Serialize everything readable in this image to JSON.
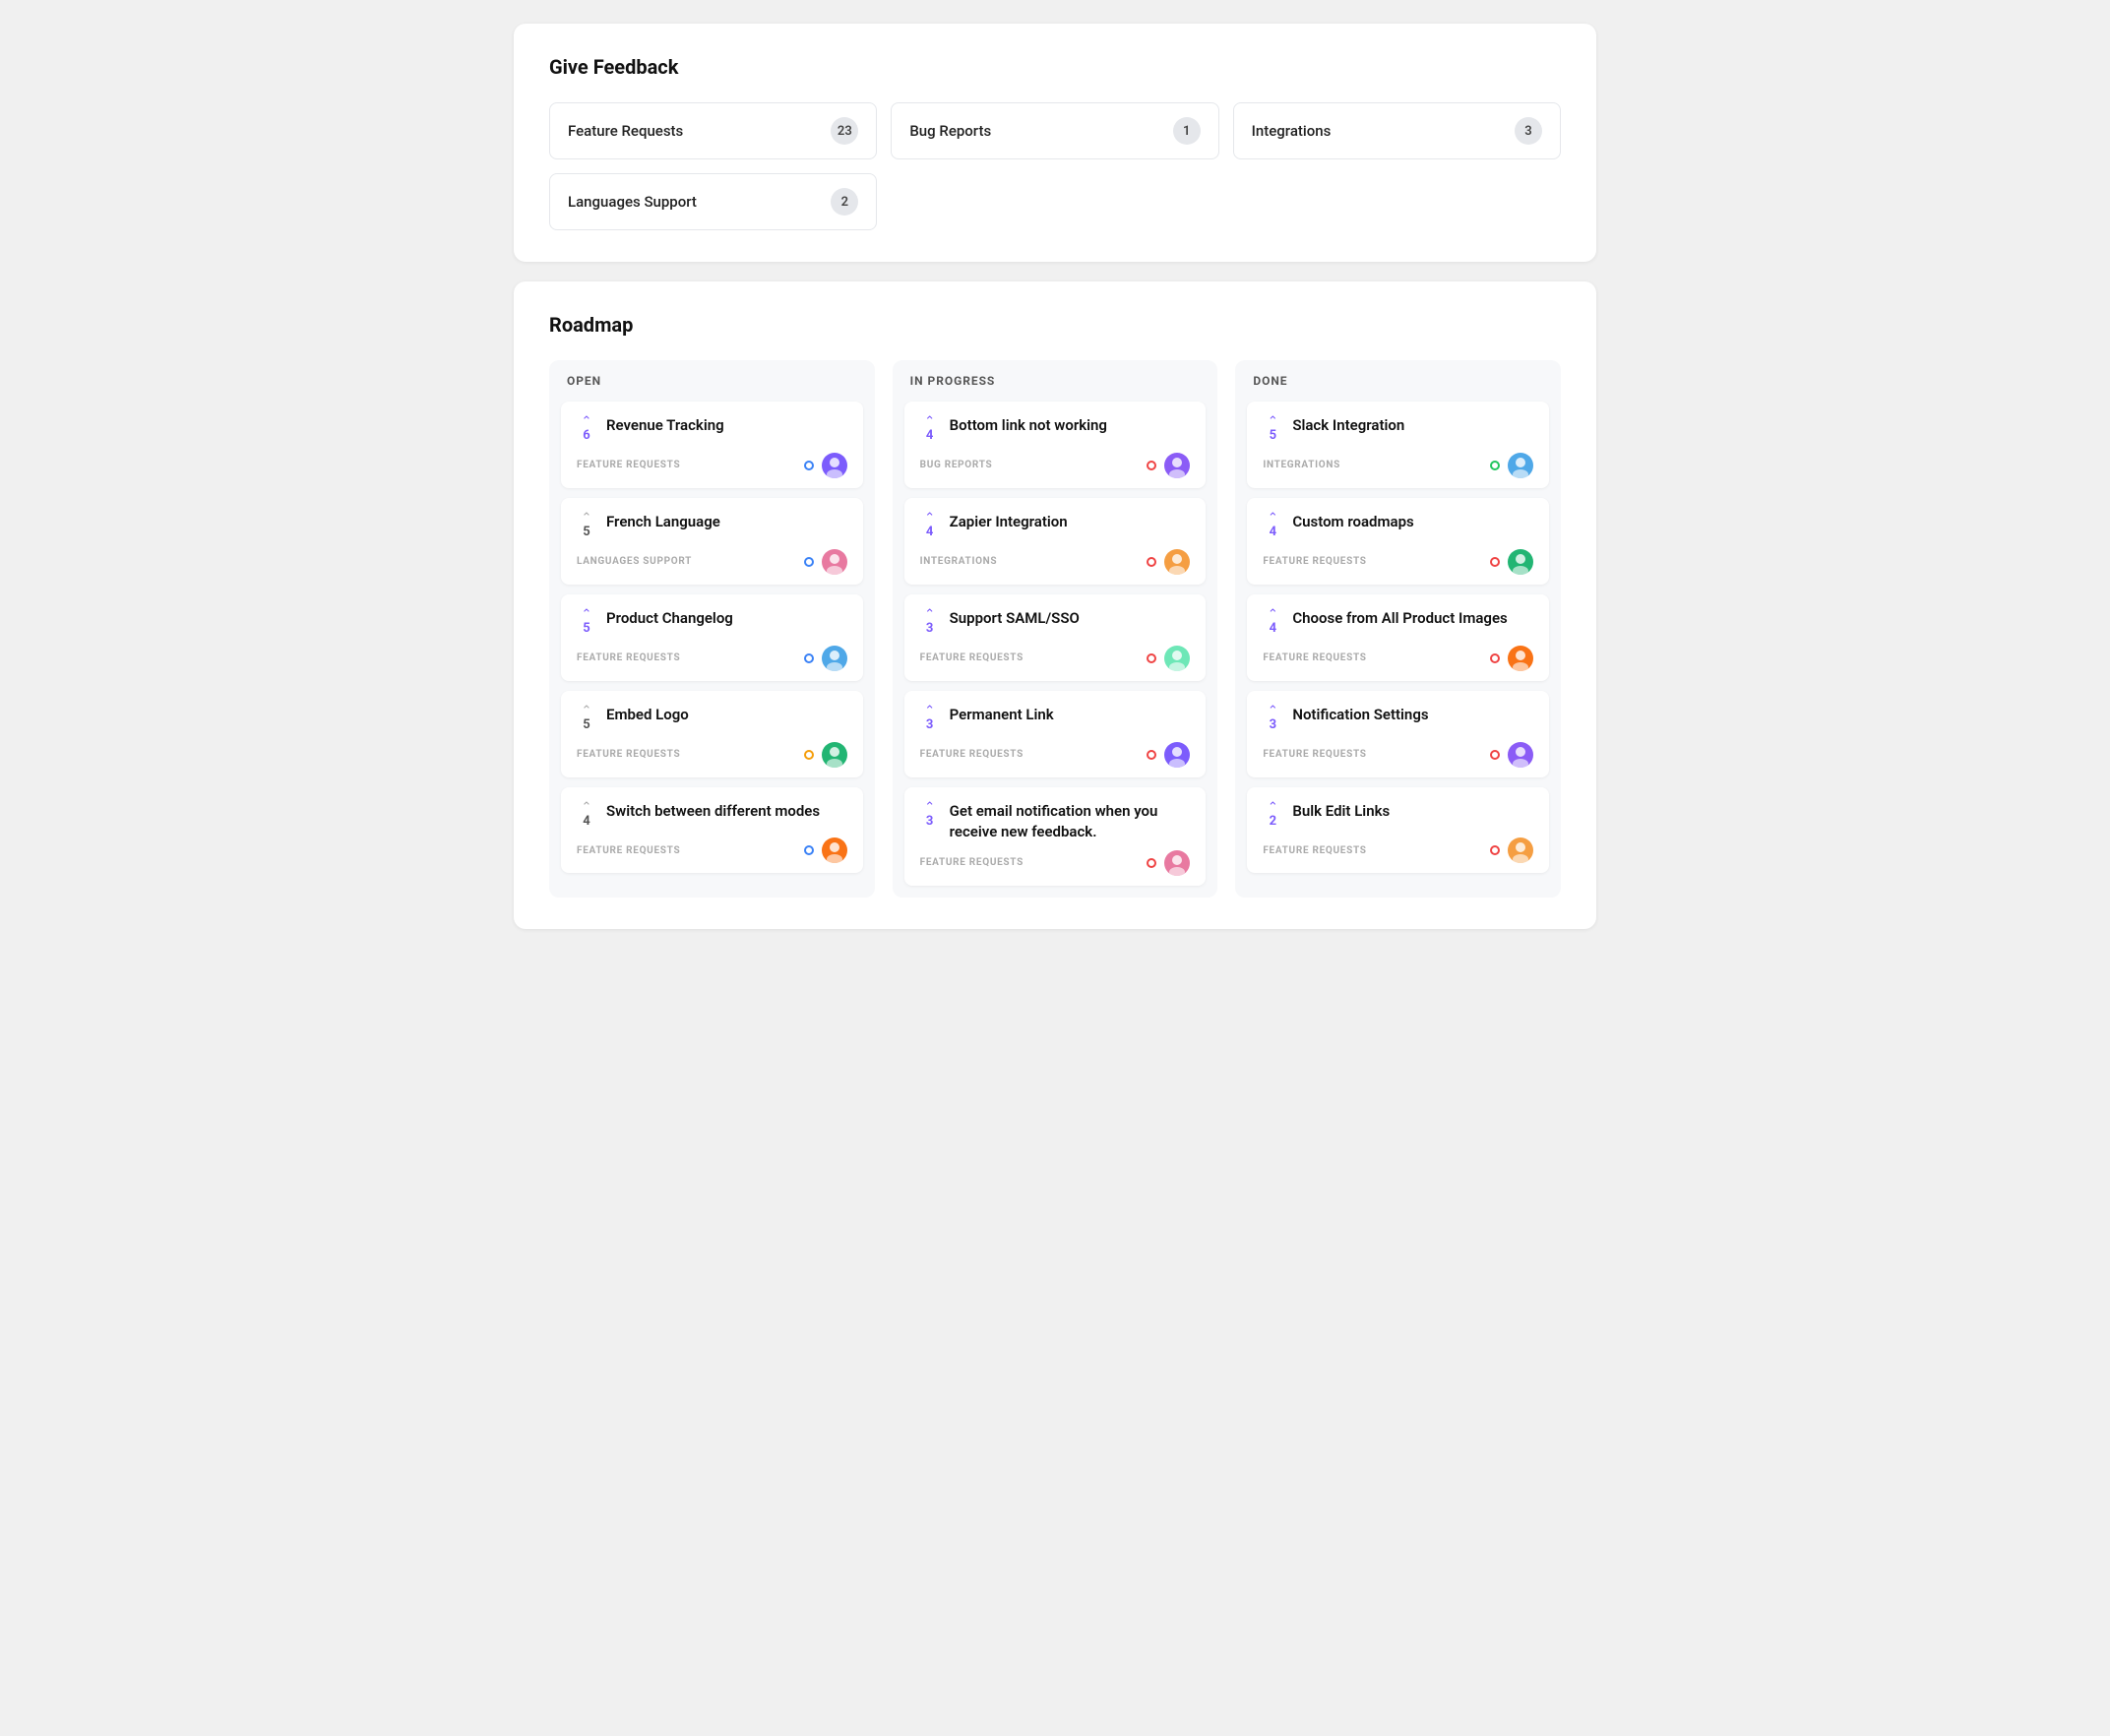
{
  "feedback": {
    "section_title": "Give Feedback",
    "items": [
      {
        "label": "Feature Requests",
        "count": "23"
      },
      {
        "label": "Bug Reports",
        "count": "1"
      },
      {
        "label": "Integrations",
        "count": "3"
      },
      {
        "label": "Languages Support",
        "count": "2"
      }
    ]
  },
  "roadmap": {
    "section_title": "Roadmap",
    "columns": [
      {
        "header": "OPEN",
        "cards": [
          {
            "title": "Revenue Tracking",
            "votes": "6",
            "vote_style": "purple",
            "tag": "FEATURE REQUESTS",
            "dot": "blue",
            "av": "av1"
          },
          {
            "title": "French Language",
            "votes": "5",
            "vote_style": "gray",
            "tag": "LANGUAGES SUPPORT",
            "dot": "blue",
            "av": "av2"
          },
          {
            "title": "Product Changelog",
            "votes": "5",
            "vote_style": "purple",
            "tag": "FEATURE REQUESTS",
            "dot": "blue",
            "av": "av3"
          },
          {
            "title": "Embed Logo",
            "votes": "5",
            "vote_style": "gray",
            "tag": "FEATURE REQUESTS",
            "dot": "yellow",
            "av": "av4"
          },
          {
            "title": "Switch between different modes",
            "votes": "4",
            "vote_style": "gray",
            "tag": "FEATURE REQUESTS",
            "dot": "blue",
            "av": "av5"
          }
        ]
      },
      {
        "header": "IN PROGRESS",
        "cards": [
          {
            "title": "Bottom link not working",
            "votes": "4",
            "vote_style": "purple",
            "tag": "BUG REPORTS",
            "dot": "red",
            "av": "av6"
          },
          {
            "title": "Zapier Integration",
            "votes": "4",
            "vote_style": "purple",
            "tag": "INTEGRATIONS",
            "dot": "red",
            "av": "av7"
          },
          {
            "title": "Support SAML/SSO",
            "votes": "3",
            "vote_style": "purple",
            "tag": "FEATURE REQUESTS",
            "dot": "red",
            "av": "av8"
          },
          {
            "title": "Permanent Link",
            "votes": "3",
            "vote_style": "purple",
            "tag": "FEATURE REQUESTS",
            "dot": "red",
            "av": "av1"
          },
          {
            "title": "Get email notification when you receive new feedback.",
            "votes": "3",
            "vote_style": "purple",
            "tag": "FEATURE REQUESTS",
            "dot": "red",
            "av": "av2"
          }
        ]
      },
      {
        "header": "DONE",
        "cards": [
          {
            "title": "Slack Integration",
            "votes": "5",
            "vote_style": "purple",
            "tag": "INTEGRATIONS",
            "dot": "green",
            "av": "av3"
          },
          {
            "title": "Custom roadmaps",
            "votes": "4",
            "vote_style": "purple",
            "tag": "FEATURE REQUESTS",
            "dot": "red",
            "av": "av4"
          },
          {
            "title": "Choose from All Product Images",
            "votes": "4",
            "vote_style": "purple",
            "tag": "FEATURE REQUESTS",
            "dot": "red",
            "av": "av5"
          },
          {
            "title": "Notification Settings",
            "votes": "3",
            "vote_style": "purple",
            "tag": "FEATURE REQUESTS",
            "dot": "red",
            "av": "av6"
          },
          {
            "title": "Bulk Edit Links",
            "votes": "2",
            "vote_style": "purple",
            "tag": "FEATURE REQUESTS",
            "dot": "red",
            "av": "av7"
          }
        ]
      }
    ]
  }
}
